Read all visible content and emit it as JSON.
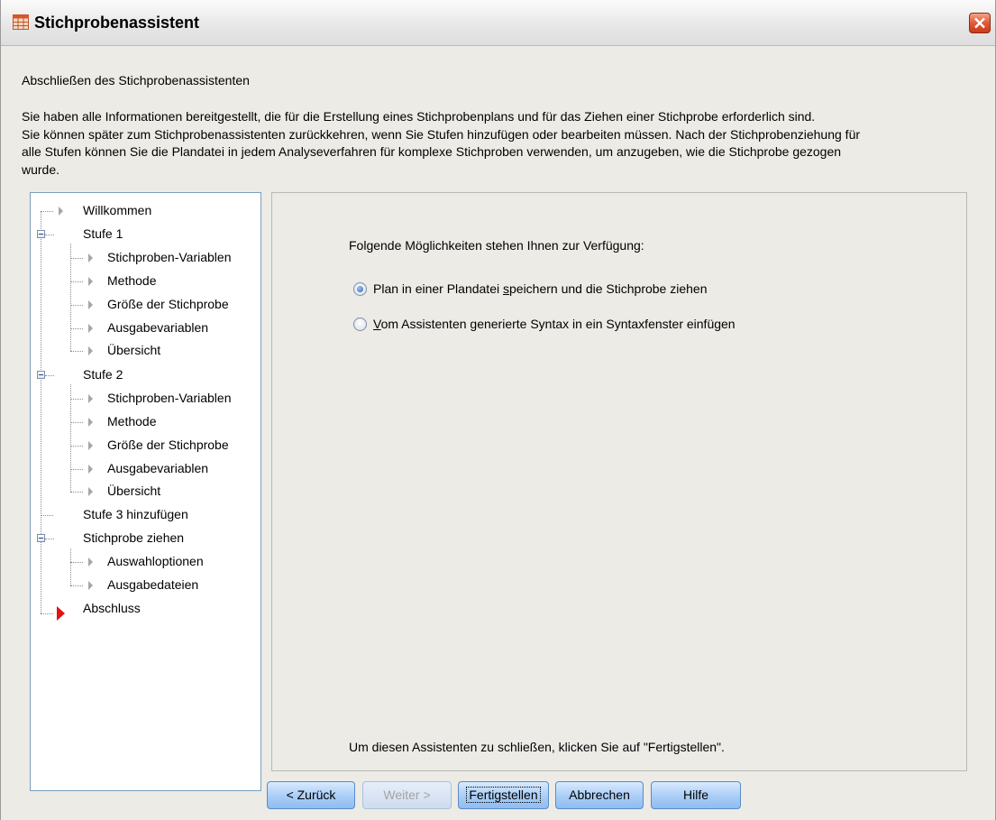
{
  "window": {
    "title": "Stichprobenassistent",
    "close_icon": "close-icon"
  },
  "header": {
    "heading": "Abschließen des Stichprobenassistenten",
    "description_lines": [
      "Sie haben alle Informationen bereitgestellt, die für die Erstellung eines Stichprobenplans und für das Ziehen einer Stichprobe erforderlich sind.",
      "Sie können später zum Stichprobenassistenten zurückkehren, wenn Sie Stufen hinzufügen oder bearbeiten müssen. Nach der Stichprobenziehung für",
      "alle Stufen können Sie die Plandatei in jedem Analyseverfahren für komplexe Stichproben verwenden, um anzugeben, wie die Stichprobe gezogen",
      "wurde."
    ]
  },
  "nav": {
    "items": [
      {
        "label": "Willkommen"
      },
      {
        "label": "Stufe 1"
      },
      {
        "label": "Stichproben-Variablen"
      },
      {
        "label": "Methode"
      },
      {
        "label": "Größe der Stichprobe"
      },
      {
        "label": "Ausgabevariablen"
      },
      {
        "label": "Übersicht"
      },
      {
        "label": "Stufe 2"
      },
      {
        "label": "Stichproben-Variablen"
      },
      {
        "label": "Methode"
      },
      {
        "label": "Größe der Stichprobe"
      },
      {
        "label": "Ausgabevariablen"
      },
      {
        "label": "Übersicht"
      },
      {
        "label": "Stufe 3 hinzufügen"
      },
      {
        "label": "Stichprobe ziehen"
      },
      {
        "label": "Auswahloptionen"
      },
      {
        "label": "Ausgabedateien"
      },
      {
        "label": "Abschluss"
      }
    ]
  },
  "main": {
    "prompt": "Folgende Möglichkeiten stehen Ihnen zur Verfügung:",
    "options": [
      {
        "pre": "Plan in einer Plandatei ",
        "key": "s",
        "post": "peichern und die Stichprobe ziehen",
        "checked": true
      },
      {
        "pre": "",
        "key": "V",
        "post": "om Assistenten generierte Syntax in ein Syntaxfenster einfügen",
        "checked": false
      }
    ],
    "finish_hint": "Um diesen Assistenten zu schließen, klicken Sie auf \"Fertigstellen\"."
  },
  "buttons": {
    "back": "< Zurück",
    "next": "Weiter >",
    "finish": "Fertigstellen",
    "cancel": "Abbrechen",
    "help": "Hilfe"
  },
  "colors": {
    "active_step": "#e01414",
    "button_blue": "#a9cdf6"
  }
}
